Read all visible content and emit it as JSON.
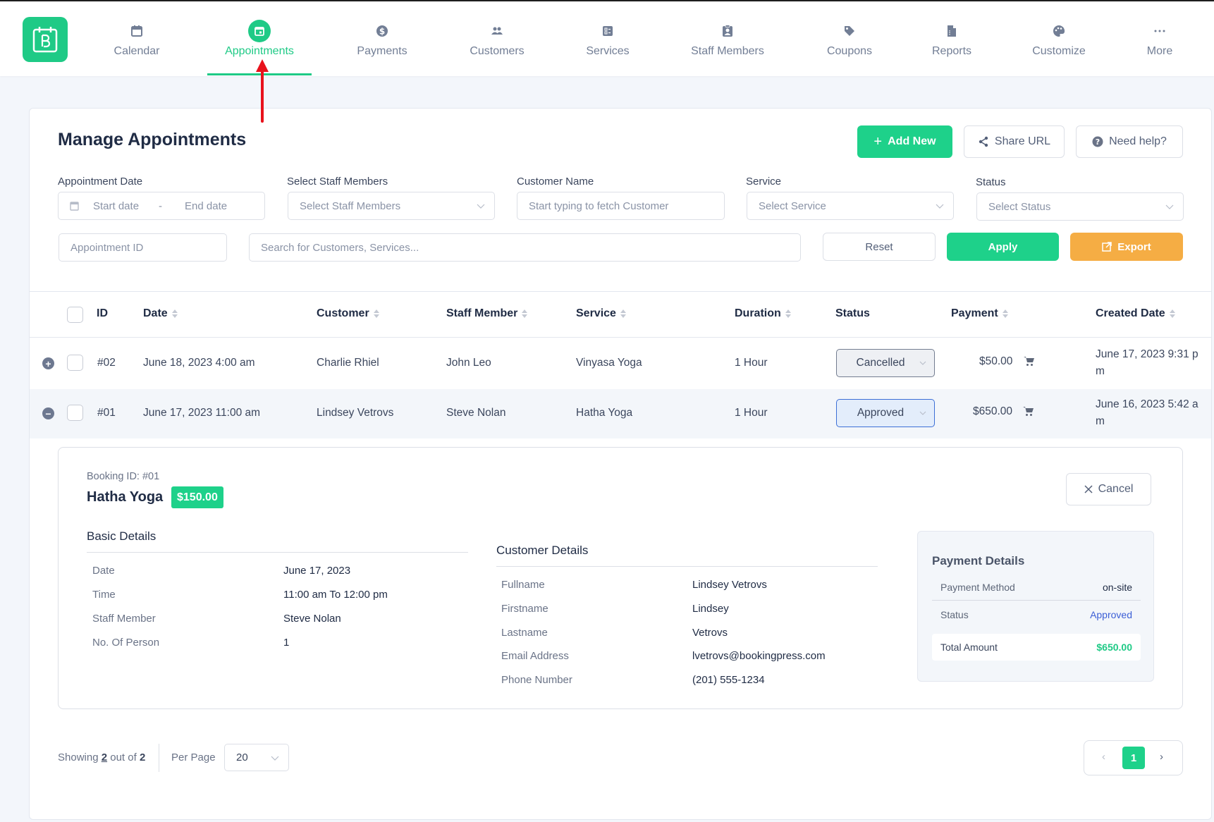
{
  "nav": {
    "items": [
      {
        "label": "Calendar",
        "icon": "calendar-icon"
      },
      {
        "label": "Appointments",
        "icon": "appointments-icon",
        "active": true
      },
      {
        "label": "Payments",
        "icon": "dollar-icon"
      },
      {
        "label": "Customers",
        "icon": "users-icon"
      },
      {
        "label": "Services",
        "icon": "services-icon"
      },
      {
        "label": "Staff Members",
        "icon": "staff-badge-icon"
      },
      {
        "label": "Coupons",
        "icon": "tag-icon"
      },
      {
        "label": "Reports",
        "icon": "report-icon"
      },
      {
        "label": "Customize",
        "icon": "palette-icon"
      },
      {
        "label": "More",
        "icon": "more-dots-icon"
      }
    ]
  },
  "page": {
    "title": "Manage Appointments",
    "add_new": "Add New",
    "share_url": "Share URL",
    "need_help": "Need help?"
  },
  "filters": {
    "appointment_date_label": "Appointment Date",
    "start_date_placeholder": "Start date",
    "date_separator": "-",
    "end_date_placeholder": "End date",
    "staff_label": "Select Staff Members",
    "staff_placeholder": "Select Staff Members",
    "customer_label": "Customer Name",
    "customer_placeholder": "Start typing to fetch Customer",
    "service_label": "Service",
    "service_placeholder": "Select Service",
    "status_label": "Status",
    "status_placeholder": "Select Status",
    "appointment_id_placeholder": "Appointment ID",
    "search_placeholder": "Search for Customers, Services...",
    "reset": "Reset",
    "apply": "Apply",
    "export": "Export"
  },
  "table": {
    "headers": {
      "id": "ID",
      "date": "Date",
      "customer": "Customer",
      "staff": "Staff Member",
      "service": "Service",
      "duration": "Duration",
      "status": "Status",
      "payment": "Payment",
      "created": "Created Date"
    },
    "rows": [
      {
        "id": "#02",
        "date": "June 18, 2023 4:00 am",
        "customer": "Charlie Rhiel",
        "staff": "John Leo",
        "service": "Vinyasa Yoga",
        "duration": "1 Hour",
        "status": "Cancelled",
        "payment": "$50.00",
        "created_line1": "June 17, 2023 9:31 p",
        "created_line2": "m",
        "expanded": false
      },
      {
        "id": "#01",
        "date": "June 17, 2023 11:00 am",
        "customer": "Lindsey Vetrovs",
        "staff": "Steve Nolan",
        "service": "Hatha Yoga",
        "duration": "1 Hour",
        "status": "Approved",
        "payment": "$650.00",
        "created_line1": "June 16, 2023 5:42 a",
        "created_line2": "m",
        "expanded": true
      }
    ]
  },
  "detail": {
    "booking_id": "Booking ID: #01",
    "service_name": "Hatha Yoga",
    "service_price": "$150.00",
    "cancel": "Cancel",
    "basic_title": "Basic Details",
    "basic": [
      {
        "k": "Date",
        "v": "June 17, 2023"
      },
      {
        "k": "Time",
        "v": "11:00 am To 12:00 pm"
      },
      {
        "k": "Staff Member",
        "v": "Steve Nolan"
      },
      {
        "k": "No. Of Person",
        "v": "1"
      }
    ],
    "customer_title": "Customer Details",
    "customer": [
      {
        "k": "Fullname",
        "v": "Lindsey Vetrovs"
      },
      {
        "k": "Firstname",
        "v": "Lindsey"
      },
      {
        "k": "Lastname",
        "v": "Vetrovs"
      },
      {
        "k": "Email Address",
        "v": "lvetrovs@bookingpress.com"
      },
      {
        "k": "Phone Number",
        "v": "(201) 555-1234"
      }
    ],
    "payment_title": "Payment Details",
    "payment": {
      "method_label": "Payment Method",
      "method": "on-site",
      "status_label": "Status",
      "status": "Approved",
      "total_label": "Total Amount",
      "total": "$650.00"
    }
  },
  "footer": {
    "showing_prefix": "Showing",
    "showing_count": "2",
    "showing_mid": "out of",
    "showing_total": "2",
    "per_page_label": "Per Page",
    "per_page_value": "20",
    "current_page": "1"
  },
  "colors": {
    "accent": "#1ed18a",
    "export": "#f5ad44",
    "approved_text": "#3c5fd6",
    "total_amount": "#1fca86",
    "annotation_arrow": "#e8121c"
  }
}
